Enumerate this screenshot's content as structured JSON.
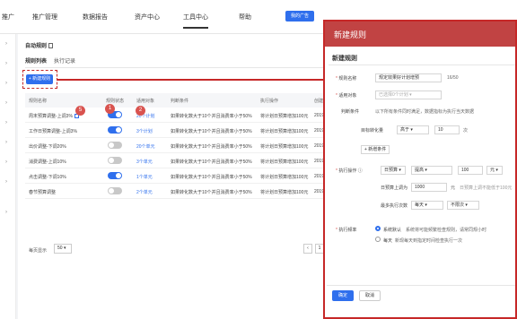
{
  "nav": {
    "items": [
      "推广",
      "推广管理",
      "数据报告",
      "资产中心",
      "工具中心",
      "帮助"
    ],
    "ad_button": "我的广告"
  },
  "main": {
    "title": "自动规则",
    "tabs": [
      "规则列表",
      "执行记录"
    ],
    "new_rule_button": "+ 新建规则",
    "columns": [
      "规则名称",
      "规则状态",
      "适用对象",
      "判断条件",
      "执行操作",
      "创建时"
    ],
    "rows": [
      {
        "name": "周末预算调整-上调3%",
        "status": "on",
        "target": "20个计划",
        "condition": "如果转化数大于10个并且消费率小于50%",
        "action": "将计划日预算增加100元",
        "created": "2019-"
      },
      {
        "name": "工作日预算调整-上调3%",
        "status": "on",
        "target": "3个计划",
        "condition": "如果转化数大于10个并且消费率小于50%",
        "action": "将计划日预算增加100元",
        "created": "2019-"
      },
      {
        "name": "出价调整-下调20%",
        "status": "off",
        "target": "20个单元",
        "condition": "如果转化数大于10个并且消费率小于50%",
        "action": "将计划日预算增加100元",
        "created": "2019-"
      },
      {
        "name": "消费调整-上调10%",
        "status": "off",
        "target": "3个单元",
        "condition": "如果转化数大于10个并且消费率小于50%",
        "action": "将计划日预算增加100元",
        "created": "2019-"
      },
      {
        "name": "点击调整-下调10%",
        "status": "on",
        "target": "1个单元",
        "condition": "如果转化数大于10个并且消费率小于50%",
        "action": "将计划日预算增加100元",
        "created": "2019-"
      },
      {
        "name": "春节预算调整",
        "status": "off",
        "target": "2个单元",
        "condition": "如果转化数大于10个并且消费率小于50%",
        "action": "将计划日预算增加100元",
        "created": "2019-"
      }
    ],
    "badges": [
      "5",
      "1",
      "2"
    ],
    "pager": {
      "label": "每页显示",
      "size": "50",
      "page": "1"
    }
  },
  "drawer": {
    "title": "新建规则",
    "subtitle": "新建规则",
    "rule_name_label": "规则名称",
    "rule_name_value": "规定效果好计划增预",
    "rule_name_count": "16/50",
    "target_label": "适用对象",
    "target_placeholder": "已选择0个计划",
    "condition_label": "判断条件",
    "condition_hint": "以下所有条件同时满足，数据指标为执行当天数据",
    "cond_metric": "目标转化量",
    "cond_op": "高于",
    "cond_value": "10",
    "cond_unit": "次",
    "add_condition": "+ 新增条件",
    "action_label": "执行操作",
    "action_type": "日预算",
    "action_dir": "提高",
    "action_value": "100",
    "action_unit": "元",
    "adjust_label": "日预算上调为",
    "adjust_value": "1000",
    "adjust_unit": "元",
    "adjust_hint": "日预算上调不能低于100元",
    "max_label": "最多执行次数",
    "max_freq": "每天",
    "max_limit": "不限次",
    "freq_label": "执行频率",
    "freq_opt1": "系统默认",
    "freq_opt1_hint": "系统将可能频繁检查规则，请常同规小时",
    "freq_opt2": "每天",
    "freq_opt2_hint": "新现每天到指定时间检查执行一次",
    "ok": "确定",
    "cancel": "取消"
  }
}
